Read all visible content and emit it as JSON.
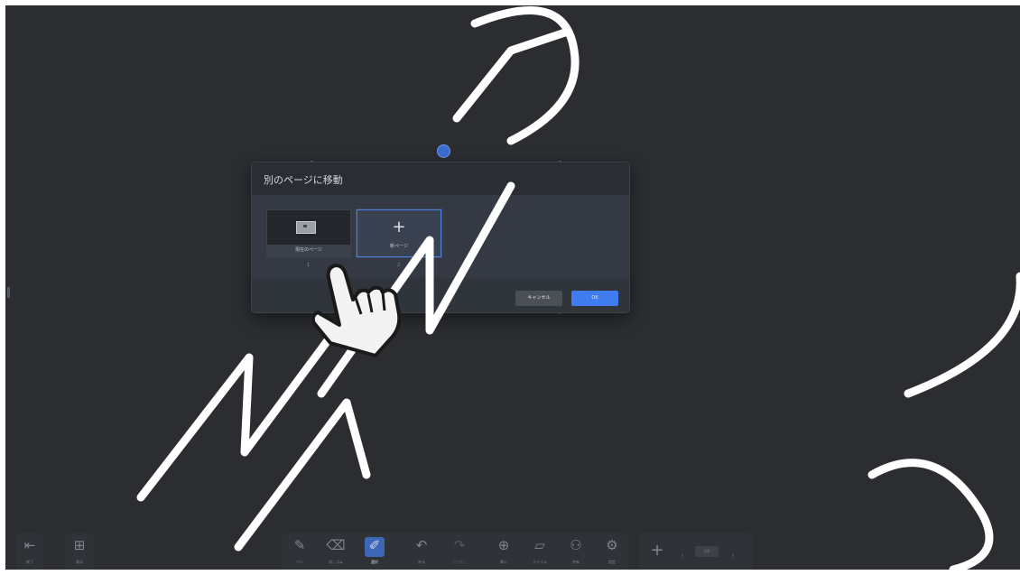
{
  "dialog": {
    "title": "別のページに移動",
    "current_page_label": "現在のページ",
    "new_page_label": "新ページ",
    "page_numbers": [
      "1",
      "2"
    ],
    "cancel_label": "キャンセル",
    "ok_label": "OK"
  },
  "toolbar": {
    "exit": {
      "icon": "exit-icon",
      "label": "終了"
    },
    "menu": {
      "icon": "grid-menu-icon",
      "label": "表示"
    },
    "pen": {
      "icon": "pen-icon",
      "label": "ペン"
    },
    "eraser": {
      "icon": "eraser-icon",
      "label": "消しゴム"
    },
    "select": {
      "icon": "select-icon",
      "label": "選択"
    },
    "undo": {
      "icon": "undo-icon",
      "label": "戻る"
    },
    "redo": {
      "icon": "redo-icon",
      "label": "やり直し"
    },
    "insert": {
      "icon": "plus-circle-icon",
      "label": "挿入"
    },
    "files": {
      "icon": "folder-icon",
      "label": "ファイル"
    },
    "share": {
      "icon": "add-user-icon",
      "label": "共有"
    },
    "settings": {
      "icon": "gear-icon",
      "label": "設定"
    },
    "page_indicator": "1/2"
  },
  "watermark": {
    "text": "MAXHUB SYSTEM",
    "color": "#ffffff"
  },
  "colors": {
    "background": "#2b2d31",
    "accent": "#3e7cf0",
    "dialog": "#30343b"
  }
}
